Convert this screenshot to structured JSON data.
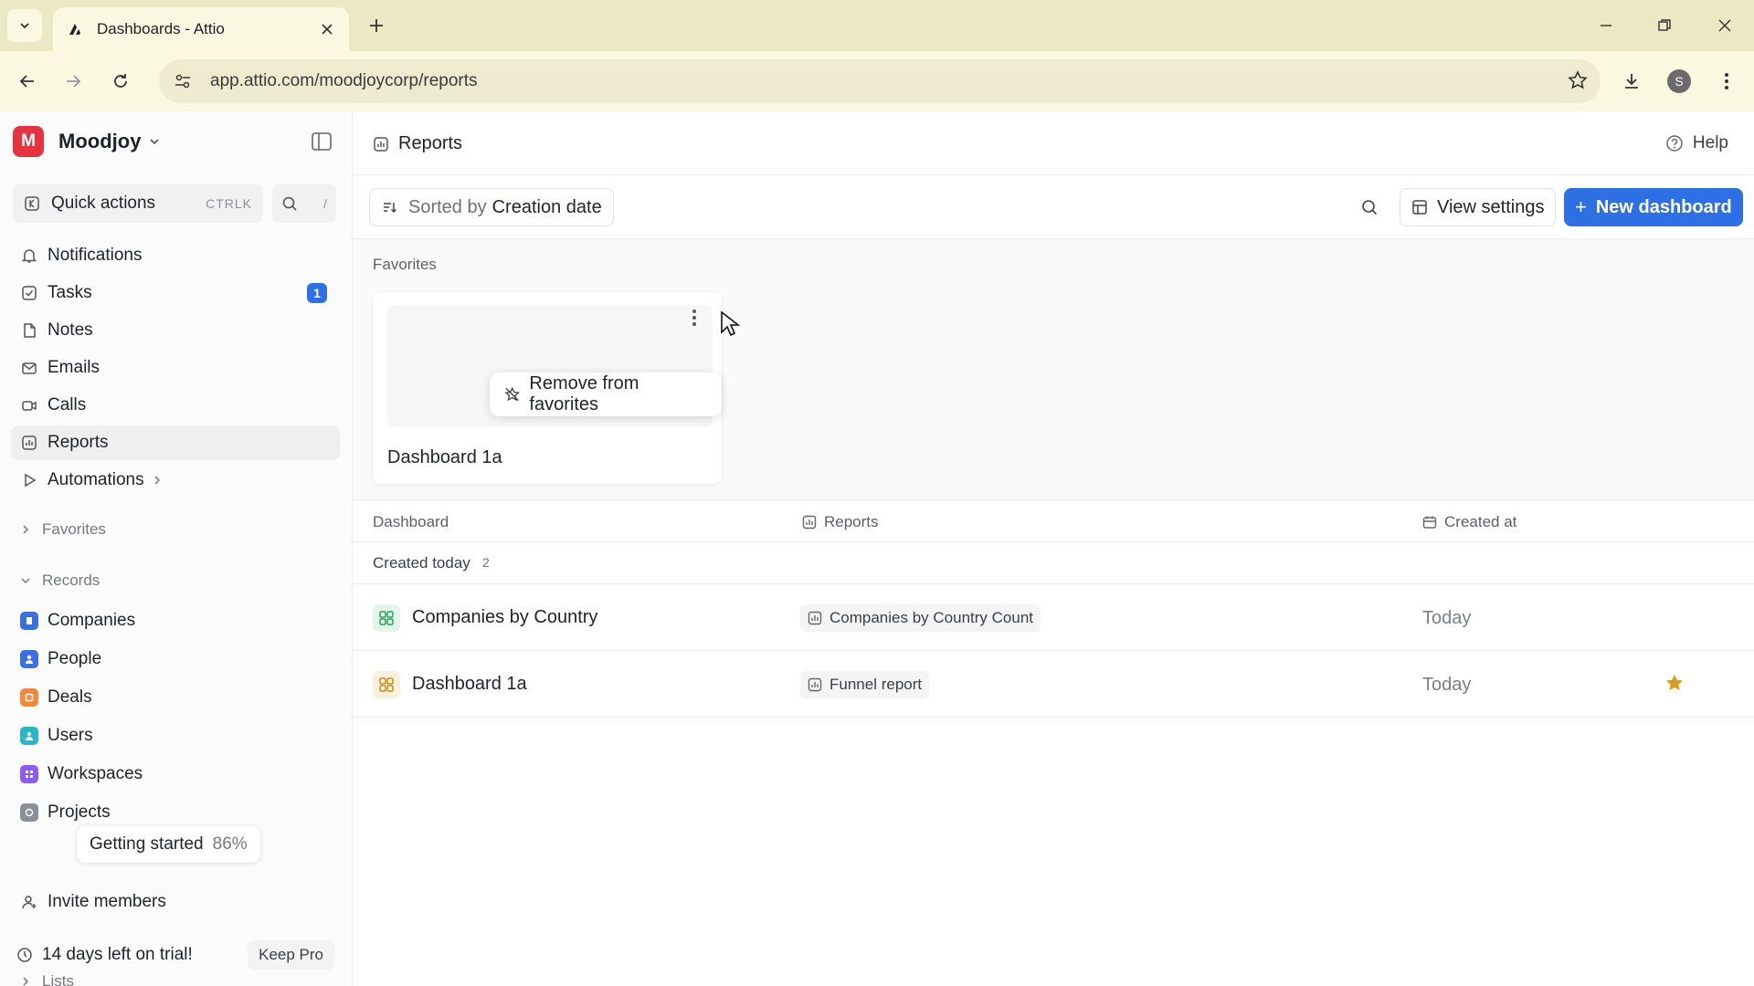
{
  "browser": {
    "tab_title": "Dashboards - Attio",
    "url": "app.attio.com/moodjoycorp/reports",
    "profile_initial": "S"
  },
  "workspace": {
    "initial": "M",
    "name": "Moodjoy"
  },
  "sidebar": {
    "quick_actions": "Quick actions",
    "quick_shortcut": "CTRLK",
    "search_shortcut": "/",
    "nav": [
      {
        "label": "Notifications"
      },
      {
        "label": "Tasks",
        "badge": "1"
      },
      {
        "label": "Notes"
      },
      {
        "label": "Emails"
      },
      {
        "label": "Calls"
      },
      {
        "label": "Reports"
      },
      {
        "label": "Automations"
      }
    ],
    "favorites_section": "Favorites",
    "records_section": "Records",
    "records": [
      {
        "label": "Companies",
        "color": "#3b6fe0"
      },
      {
        "label": "People",
        "color": "#3b6fe0"
      },
      {
        "label": "Deals",
        "color": "#f08a3c"
      },
      {
        "label": "Users",
        "color": "#2bb5c8"
      },
      {
        "label": "Workspaces",
        "color": "#8b5cf6"
      },
      {
        "label": "Projects",
        "color": "#8a8f98"
      }
    ],
    "lists_section": "Lists",
    "invite": "Invite members",
    "getting_started": "Getting started",
    "getting_started_pct": "86%",
    "trial": "14 days left on trial!",
    "keep_pro": "Keep Pro"
  },
  "main": {
    "title": "Reports",
    "help": "Help",
    "sorted_by_prefix": "Sorted by",
    "sorted_by_value": "Creation date",
    "view_settings": "View settings",
    "new_dashboard": "New dashboard",
    "favorites_label": "Favorites",
    "favorite_card_name": "Dashboard 1a",
    "popover_action": "Remove from favorites",
    "columns": {
      "dashboard": "Dashboard",
      "reports": "Reports",
      "created_at": "Created at"
    },
    "group_label": "Created today",
    "group_count": "2",
    "rows": [
      {
        "name": "Companies by Country",
        "report": "Companies by Country Count",
        "created": "Today",
        "favorite": false,
        "icon_bg": "#e3f5ea",
        "icon_color": "#2e9e5b"
      },
      {
        "name": "Dashboard 1a",
        "report": "Funnel report",
        "created": "Today",
        "favorite": true,
        "icon_bg": "#fbf0dc",
        "icon_color": "#c98a1c"
      }
    ]
  },
  "colors": {
    "accent": "#2f6fe4",
    "star": "#d99a1e",
    "brand": "#e4343f"
  }
}
